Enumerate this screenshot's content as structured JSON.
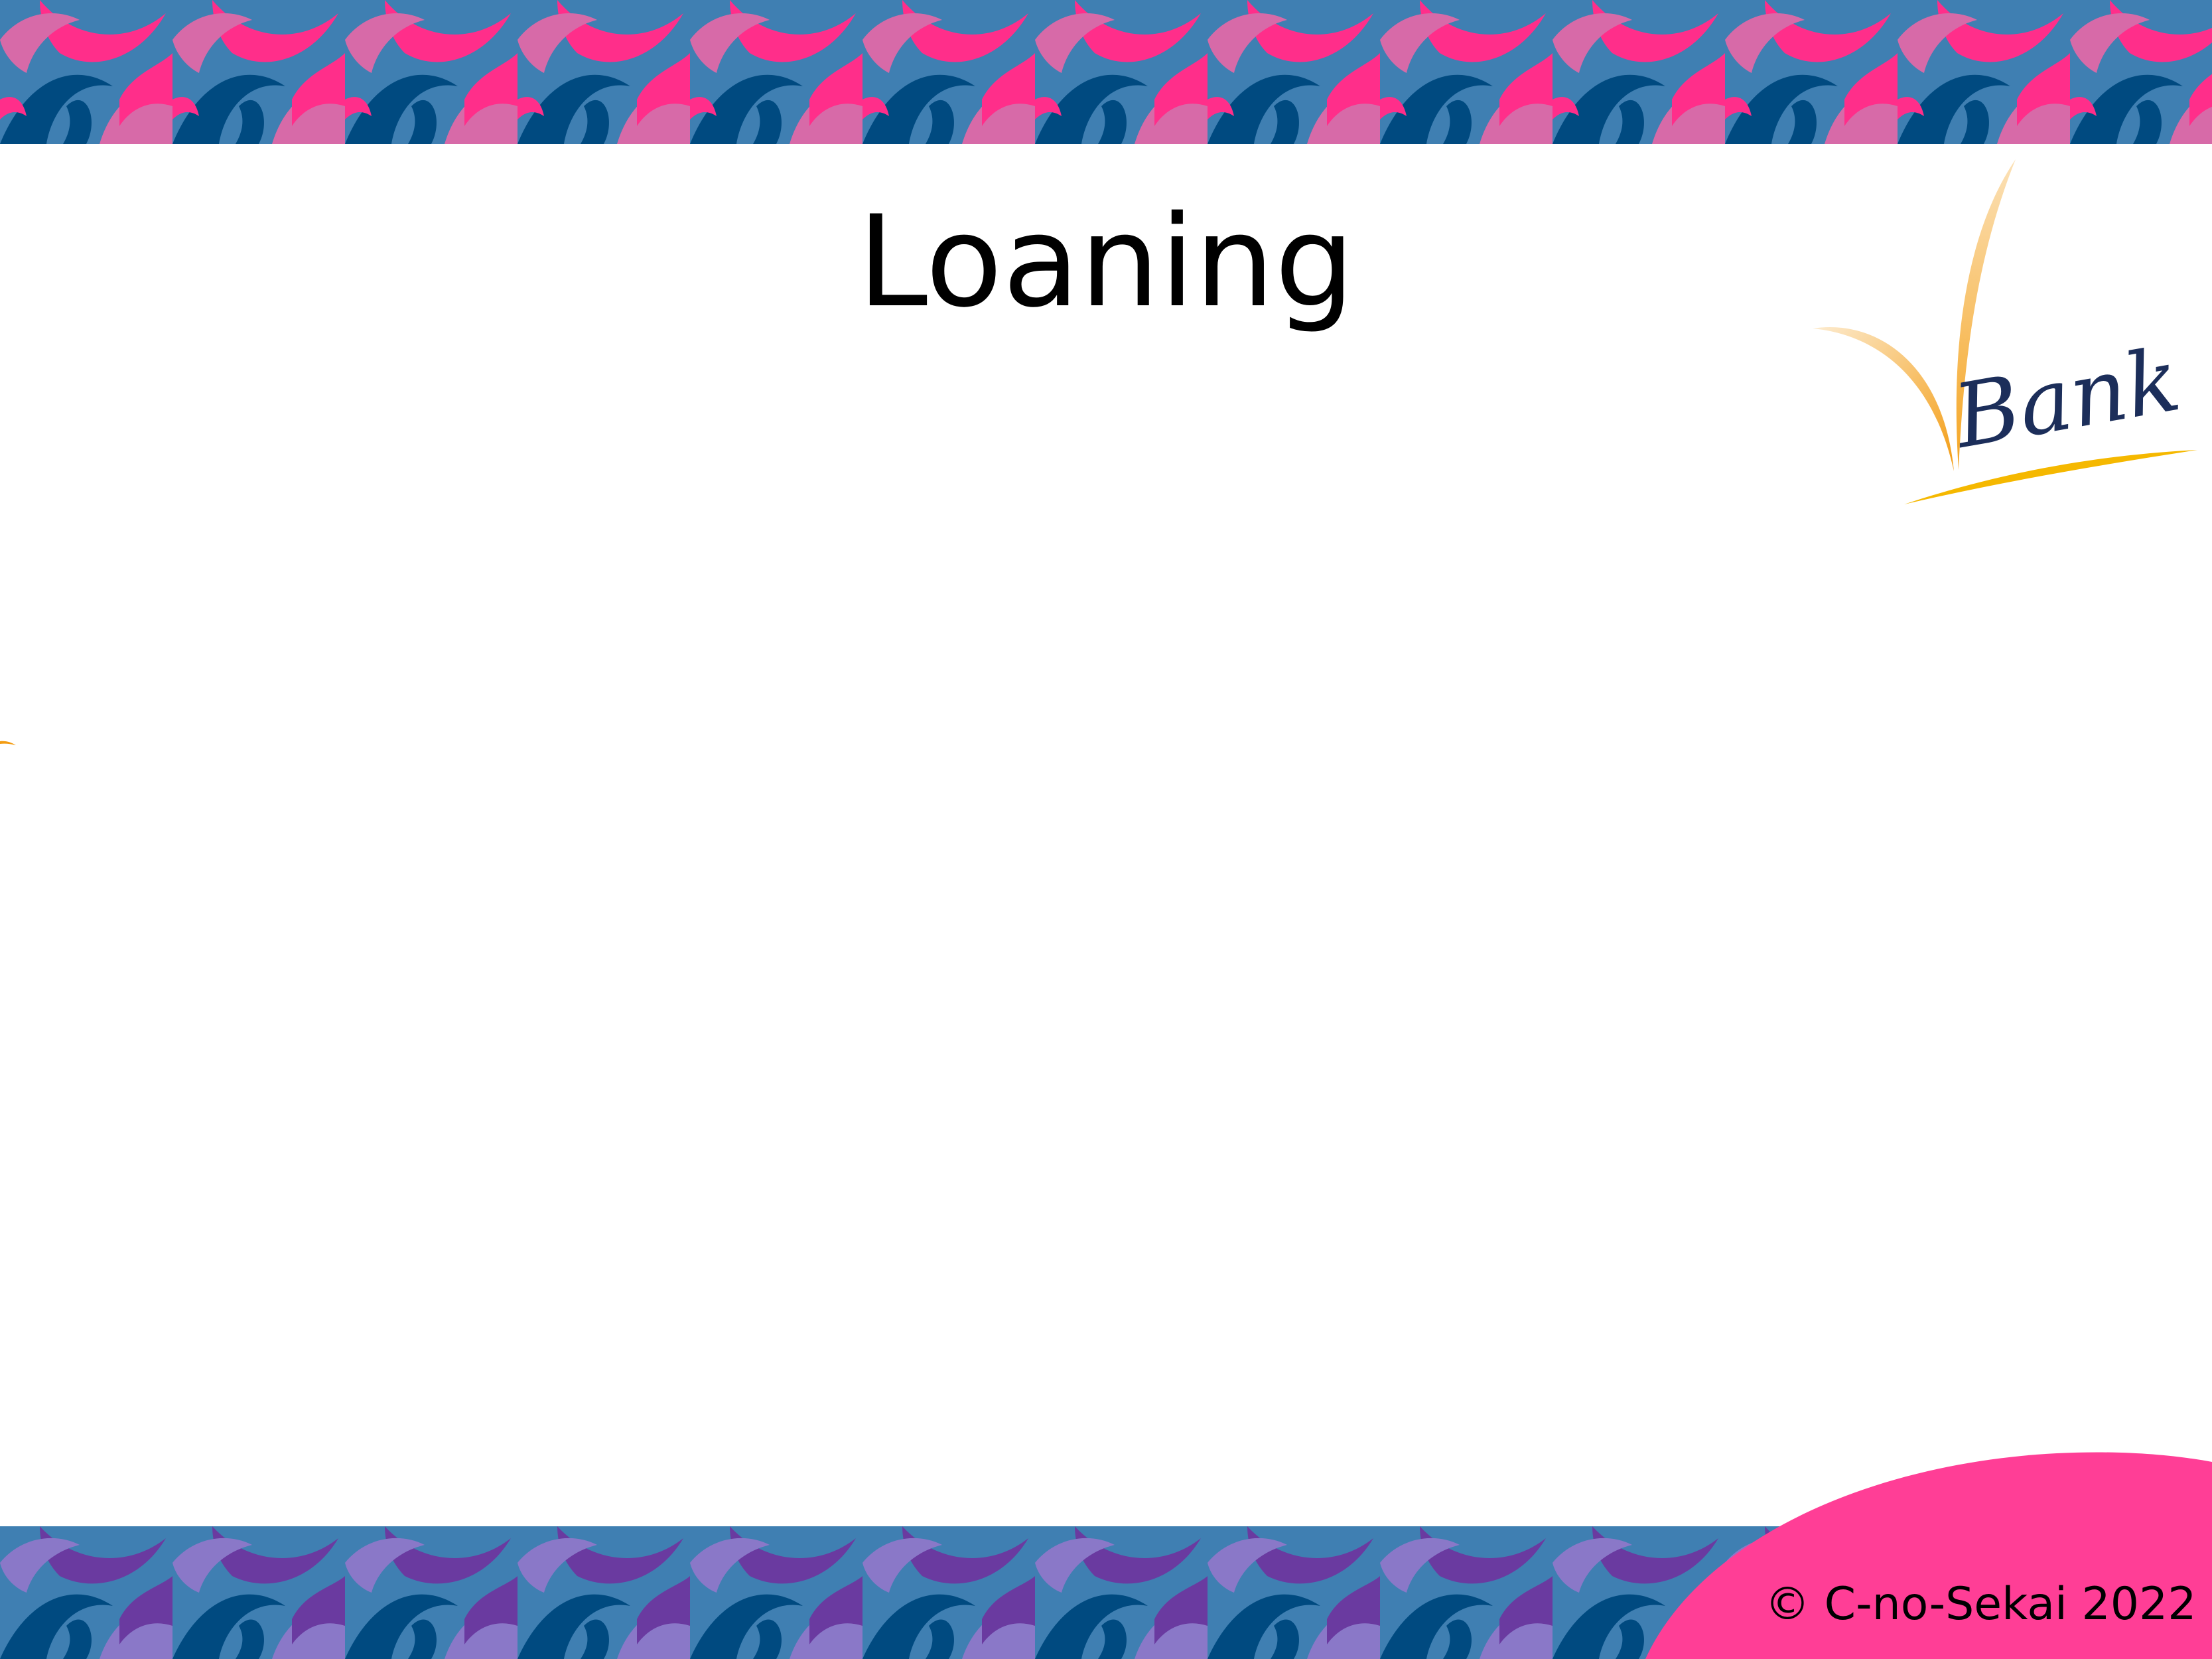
{
  "slide": {
    "title": "Loaning",
    "footer_copyright": "© C-no-Sekai 2022"
  },
  "logo": {
    "wordmark": "Bank",
    "icon": "orange-swoosh-v-icon"
  },
  "colors": {
    "background": "#ffffff",
    "top_band_dark": "#004a80",
    "top_band_mid": "#3f7fb2",
    "top_band_pink": "#ff2e8a",
    "top_band_light_pink": "#d76aa8",
    "bottom_band_dark": "#004a80",
    "bottom_band_mid": "#3f7fb2",
    "bottom_band_purple": "#6a3aa0",
    "bottom_band_lavender": "#8a78c8",
    "corner_pink": "#ff3e96",
    "logo_orange": "#f39c12",
    "logo_navy": "#1c2e5a"
  }
}
